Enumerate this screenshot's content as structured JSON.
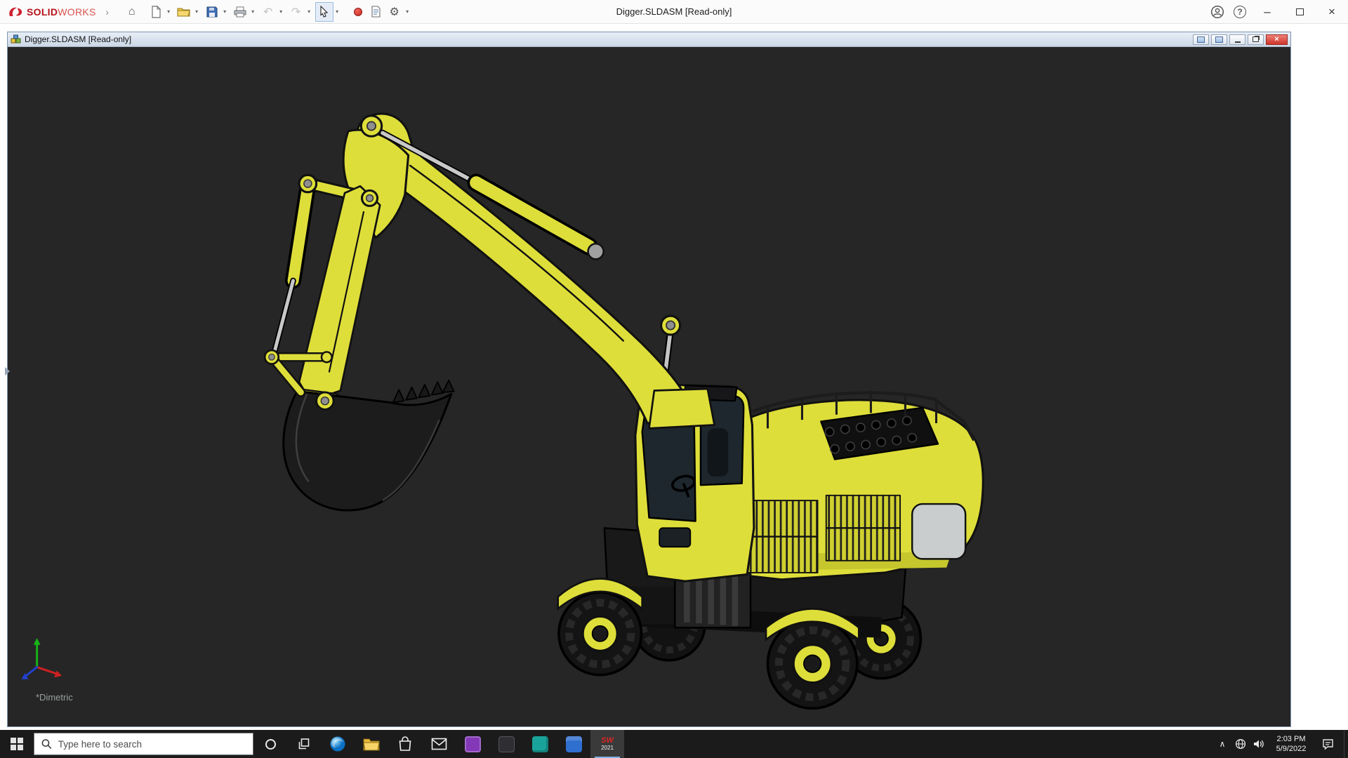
{
  "colors": {
    "accent_yellow": "#dede3a",
    "viewport_bg": "#262626",
    "taskbar_bg": "#1b1b1b",
    "doc_titlebar": "#d8e1ee",
    "close_red": "#d64541",
    "brand_red": "#cf2030"
  },
  "app_bar": {
    "brand_solid": "SOLID",
    "brand_works": "WORKS",
    "title": "Digger.SLDASM [Read-only]",
    "glyphs": {
      "flyout_arrow": "›",
      "home": "⌂",
      "undo": "↶",
      "redo": "↷",
      "gear": "⚙",
      "dropdown": "▾",
      "help": "?",
      "minimize": "–",
      "close": "×"
    }
  },
  "doc_window": {
    "title": "Digger.SLDASM [Read-only]",
    "view_label": "*Dimetric",
    "glyphs": {
      "minimize": "–",
      "close": "×"
    }
  },
  "taskbar": {
    "search_placeholder": "Type here to search",
    "sw_badge_line1": "SW",
    "sw_badge_line2": "2021",
    "tray_chevron": "∧",
    "clock_time": "2:03 PM",
    "clock_date": "5/9/2022"
  }
}
